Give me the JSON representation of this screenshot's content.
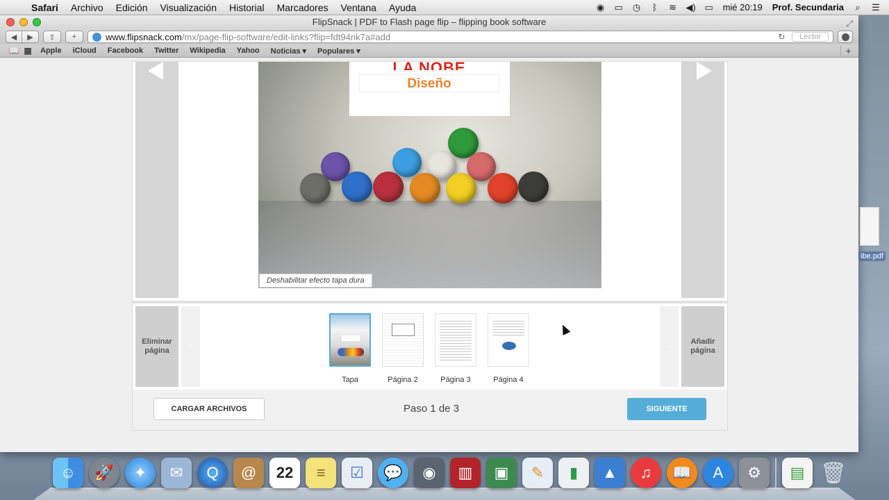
{
  "menubar": {
    "app": "Safari",
    "items": [
      "Archivo",
      "Edición",
      "Visualización",
      "Historial",
      "Marcadores",
      "Ventana",
      "Ayuda"
    ],
    "clock": "mié 20:19",
    "user": "Prof. Secundaria"
  },
  "window": {
    "title": "FlipSnack | PDF to Flash page flip – flipping book software"
  },
  "toolbar": {
    "url_domain": "www.flipsnack.com",
    "url_path": "/mx/page-flip-software/edit-links?flip=fdt94nk7a#add",
    "reader_label": "Lector"
  },
  "bookmarks": [
    "Apple",
    "iCloud",
    "Facebook",
    "Twitter",
    "Wikipedia",
    "Yahoo",
    "Noticias ▾",
    "Populares ▾"
  ],
  "cover": {
    "title_line1": "LA NOBE",
    "title_line2": "Diseño",
    "hardcover_toggle": "Deshabilitar efecto tapa dura"
  },
  "pages": {
    "delete_label": "Eliminar página",
    "add_label": "Añadir página",
    "thumbs": [
      {
        "label": "Tapa",
        "selected": true
      },
      {
        "label": "Página 2",
        "selected": false
      },
      {
        "label": "Página 3",
        "selected": false
      },
      {
        "label": "Página 4",
        "selected": false
      }
    ]
  },
  "footer": {
    "upload_label": "CARGAR ARCHIVOS",
    "step_text": "Paso 1 de 3",
    "next_label": "SIGUIENTE"
  },
  "desktop": {
    "file_label": "ibe.pdf"
  },
  "colors": {
    "accent": "#55aeda",
    "title_red": "#d42a1c",
    "title_orange": "#e8842b"
  }
}
